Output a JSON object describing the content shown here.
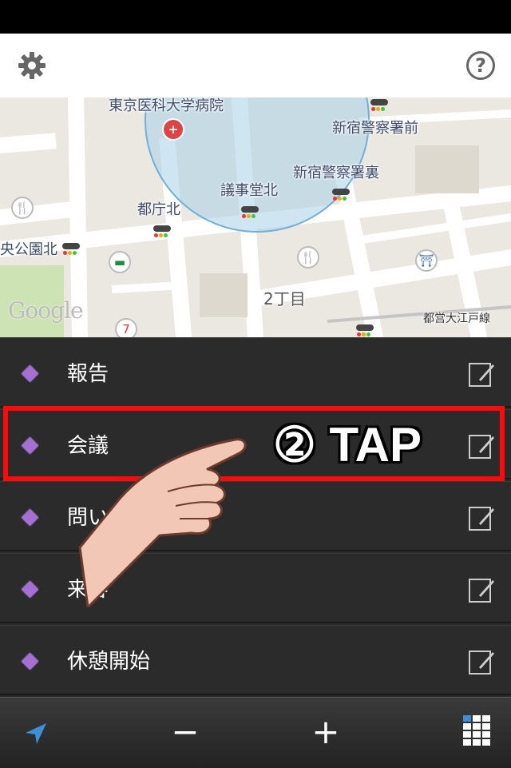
{
  "map": {
    "labels": {
      "hospital": "東京医科大学病院",
      "police_front": "新宿警察署前",
      "police_back": "新宿警察署裏",
      "gijido_kita": "議事堂北",
      "tocho_kita": "都庁北",
      "park_kita": "央公園北",
      "chome": "2丁目",
      "oedo_line": "都営大江戸線"
    },
    "attribution": "Google"
  },
  "list": {
    "items": [
      {
        "label": "報告"
      },
      {
        "label": "会議"
      },
      {
        "label": "問い合わせ報告"
      },
      {
        "label": "来客"
      },
      {
        "label": "休憩開始"
      }
    ]
  },
  "overlay": {
    "tap_text": "② TAP"
  },
  "colors": {
    "list_bg": "#2b2b2b",
    "diamond": "#a56fd6",
    "highlight": "#ff0a0a",
    "nav_accent": "#3a8fd6"
  },
  "icons": {
    "settings": "gear-icon",
    "help": "help-icon",
    "edit": "edit-icon",
    "location": "navigation-arrow-icon",
    "zoom_out": "minus-icon",
    "zoom_in": "plus-icon",
    "menu": "grid-icon"
  },
  "bottombar": {
    "minus_label": "−",
    "plus_label": "+"
  },
  "topbar": {
    "help_label": "?"
  }
}
